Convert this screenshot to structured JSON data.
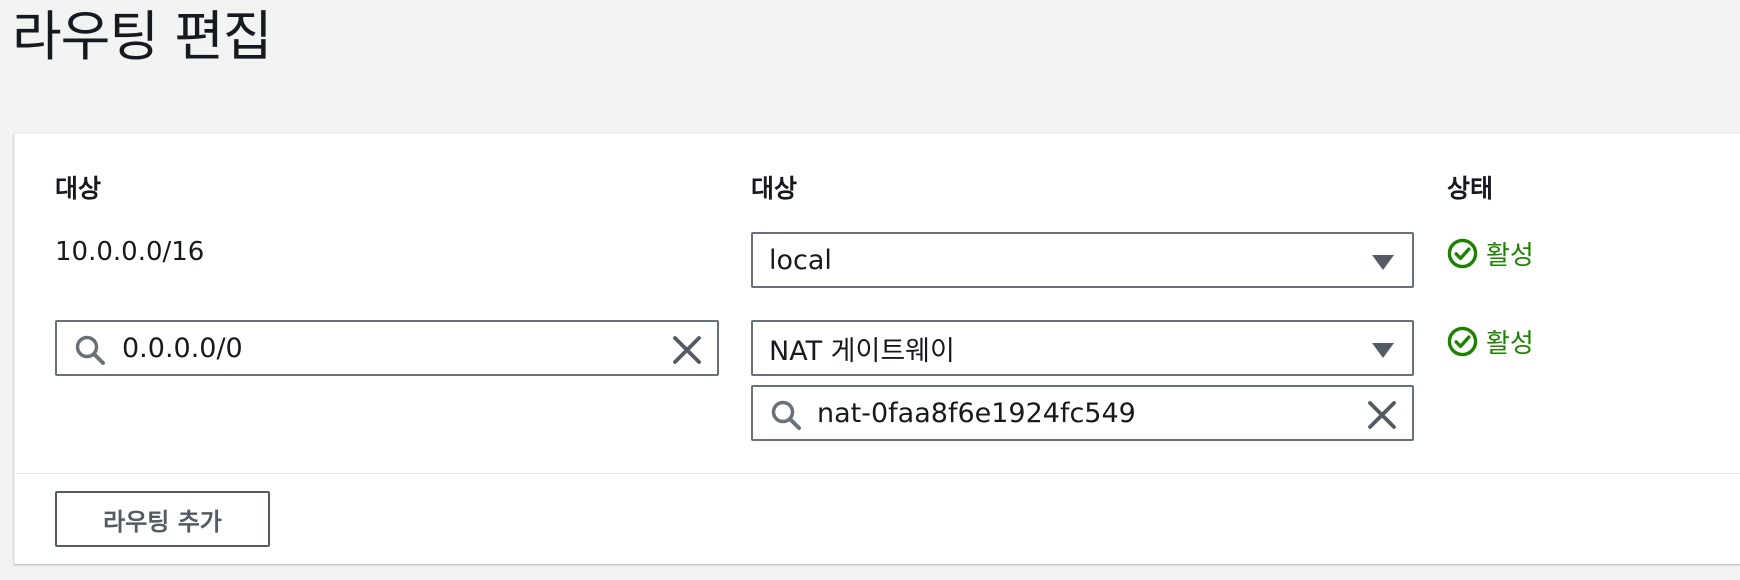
{
  "page": {
    "title": "라우팅 편집"
  },
  "table": {
    "headers": {
      "destination": "대상",
      "target": "대상",
      "status": "상태"
    },
    "rows": [
      {
        "destination_value": "10.0.0.0/16",
        "target_select": "local",
        "status": "활성"
      },
      {
        "destination_value": "0.0.0.0/0",
        "target_select": "NAT 게이트웨이",
        "target_search_value": "nat-0faa8f6e1924fc549",
        "status": "활성"
      }
    ]
  },
  "actions": {
    "add_route_label": "라우팅 추가"
  },
  "colors": {
    "accent_success": "#1d8102",
    "border": "#687078",
    "background": "#f2f3f3"
  },
  "icons": [
    "search-icon",
    "clear-icon",
    "caret-down-icon",
    "check-circle-icon"
  ]
}
